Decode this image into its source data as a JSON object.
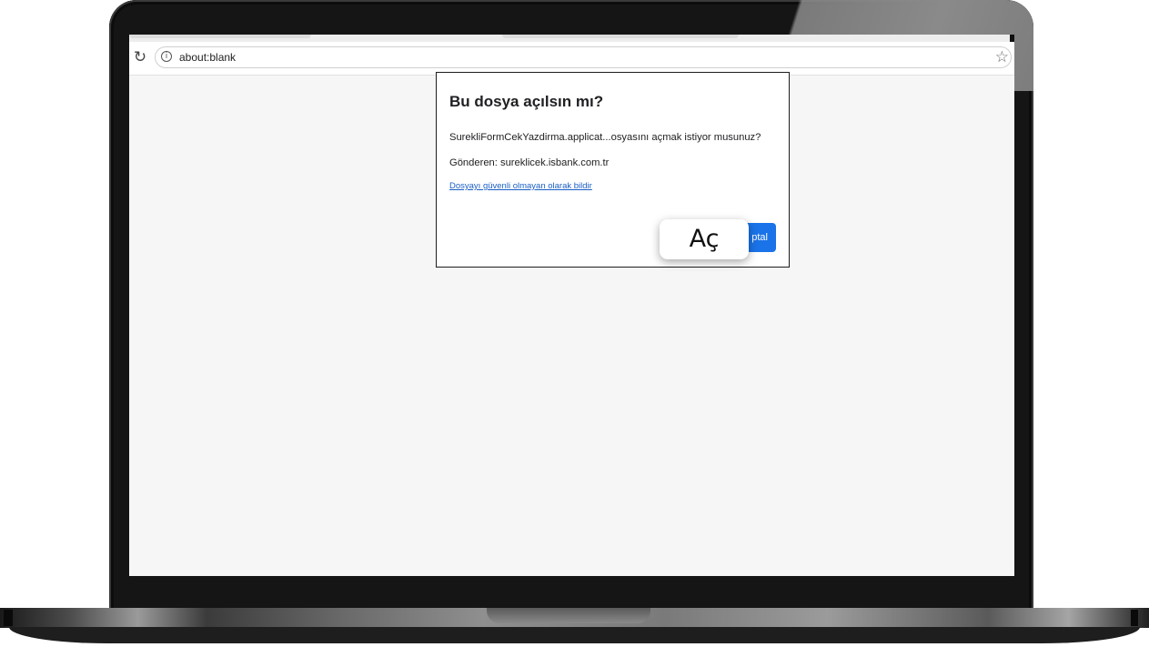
{
  "browser": {
    "address_bar": {
      "url": "about:blank"
    },
    "icons": {
      "reload": "reload-icon",
      "info": "info-icon",
      "bookmark": "star-icon"
    }
  },
  "dialog": {
    "title": "Bu dosya açılsın mı?",
    "message": "SurekliFormCekYazdirma.applicat...osyasını açmak istiyor musunuz?",
    "sender": "Gönderen: sureklicek.isbank.com.tr",
    "report_link": "Dosyayı güvenli olmayan olarak bildir",
    "cancel_label": "ptal",
    "open_label": "Aç"
  },
  "colors": {
    "primary_button": "#1a73e8",
    "link": "#1a5fc4",
    "page_background": "#f6f6f6"
  }
}
